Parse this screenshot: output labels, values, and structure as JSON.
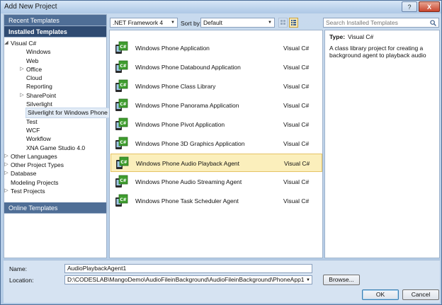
{
  "window": {
    "title": "Add New Project",
    "help_label": "?",
    "close_label": "X"
  },
  "left_pane": {
    "recent_label": "Recent Templates",
    "installed_label": "Installed Templates",
    "online_label": "Online Templates",
    "tree": [
      {
        "label": "Visual C#",
        "level": 1,
        "arrow": "expanded"
      },
      {
        "label": "Windows",
        "level": 2,
        "arrow": "none"
      },
      {
        "label": "Web",
        "level": 2,
        "arrow": "none"
      },
      {
        "label": "Office",
        "level": 2,
        "arrow": "collapsed"
      },
      {
        "label": "Cloud",
        "level": 2,
        "arrow": "none"
      },
      {
        "label": "Reporting",
        "level": 2,
        "arrow": "none"
      },
      {
        "label": "SharePoint",
        "level": 2,
        "arrow": "collapsed"
      },
      {
        "label": "Silverlight",
        "level": 2,
        "arrow": "none"
      },
      {
        "label": "Silverlight for Windows Phone",
        "level": 2,
        "arrow": "none",
        "selected": true
      },
      {
        "label": "Test",
        "level": 2,
        "arrow": "none"
      },
      {
        "label": "WCF",
        "level": 2,
        "arrow": "none"
      },
      {
        "label": "Workflow",
        "level": 2,
        "arrow": "none"
      },
      {
        "label": "XNA Game Studio 4.0",
        "level": 2,
        "arrow": "none"
      },
      {
        "label": "Other Languages",
        "level": 1,
        "arrow": "collapsed"
      },
      {
        "label": "Other Project Types",
        "level": 1,
        "arrow": "collapsed"
      },
      {
        "label": "Database",
        "level": 1,
        "arrow": "collapsed"
      },
      {
        "label": "Modeling Projects",
        "level": 1,
        "arrow": "none"
      },
      {
        "label": "Test Projects",
        "level": 1,
        "arrow": "collapsed"
      }
    ]
  },
  "toolbar": {
    "framework": ".NET Framework 4",
    "sort_label": "Sort by:",
    "sort_value": "Default",
    "search_placeholder": "Search Installed Templates"
  },
  "templates": [
    {
      "name": "Windows Phone Application",
      "lang": "Visual C#"
    },
    {
      "name": "Windows Phone Databound Application",
      "lang": "Visual C#"
    },
    {
      "name": "Windows Phone Class Library",
      "lang": "Visual C#"
    },
    {
      "name": "Windows Phone Panorama Application",
      "lang": "Visual C#"
    },
    {
      "name": "Windows Phone Pivot Application",
      "lang": "Visual C#"
    },
    {
      "name": "Windows Phone 3D Graphics Application",
      "lang": "Visual C#"
    },
    {
      "name": "Windows Phone Audio Playback Agent",
      "lang": "Visual C#",
      "selected": true
    },
    {
      "name": "Windows Phone Audio Streaming Agent",
      "lang": "Visual C#"
    },
    {
      "name": "Windows Phone Task Scheduler Agent",
      "lang": "Visual C#"
    }
  ],
  "details": {
    "type_label": "Type:",
    "type_value": "Visual C#",
    "description": "A class library project for creating a background agent to playback audio"
  },
  "form": {
    "name_label": "Name:",
    "name_value": "AudioPlaybackAgent1",
    "location_label": "Location:",
    "location_value": "D:\\CODESLAB\\MangoDemo\\AudioFileinBackground\\AudioFileinBackground\\PhoneApp1",
    "browse_label": "Browse...",
    "ok_label": "OK",
    "cancel_label": "Cancel"
  },
  "colors": {
    "selection": "#fbefbc",
    "header": "#4f6e96",
    "icon_green": "#3f9d2e"
  }
}
